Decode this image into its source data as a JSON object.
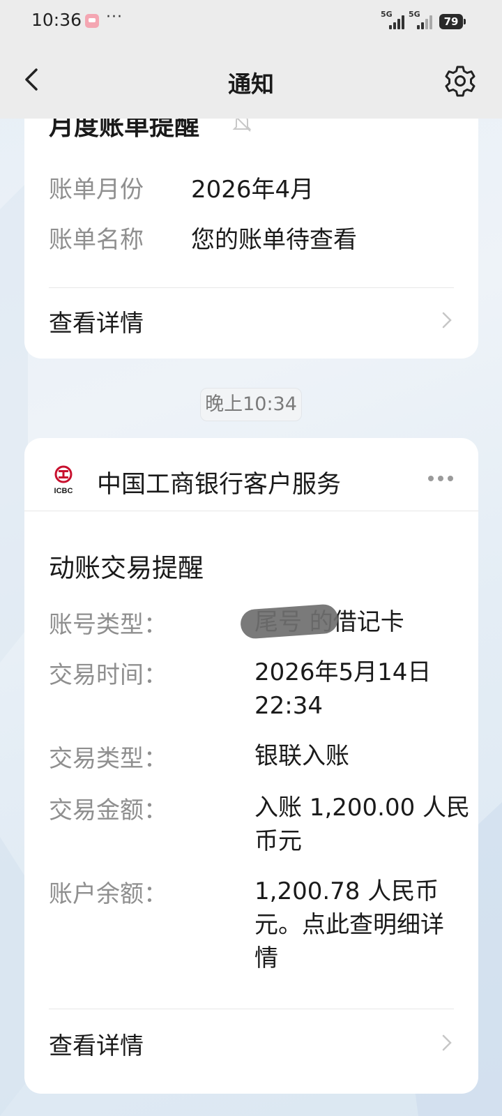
{
  "status_bar": {
    "time": "10:36",
    "more": "···",
    "signal_1": "5G",
    "signal_2": "5G",
    "battery": "79"
  },
  "header": {
    "title": "通知",
    "back_icon": "chevron-left-icon",
    "settings_icon": "gear-icon"
  },
  "card_monthly": {
    "title": "月度账单提醒",
    "rows": [
      {
        "label": "账单月份",
        "value": "2026年4月"
      },
      {
        "label": "账单名称",
        "value": "您的账单待查看"
      }
    ],
    "detail_label": "查看详情"
  },
  "timestamp": "晚上10:34",
  "card_transaction": {
    "sender": "中国工商银行客户服务",
    "logo_text": "ICBC",
    "title": "动账交易提醒",
    "rows": [
      {
        "label": "账号类型：",
        "value": "尾号    的借记卡"
      },
      {
        "label": "交易时间：",
        "value_line1": "2026年5月14日",
        "value_line2": "22:34"
      },
      {
        "label": "交易类型：",
        "value": "银联入账"
      },
      {
        "label": "交易金额：",
        "value_line1": "入账 1,200.00 人民",
        "value_line2": "币元"
      },
      {
        "label": "账户余额：",
        "value_line1": "1,200.78 人民币",
        "value_line2": "元。点此查明细详",
        "value_line3": "情"
      }
    ],
    "detail_label": "查看详情"
  },
  "colors": {
    "accent_red": "#c8102e",
    "label_gray": "#8f8f8f",
    "background": "#e6eef6"
  }
}
